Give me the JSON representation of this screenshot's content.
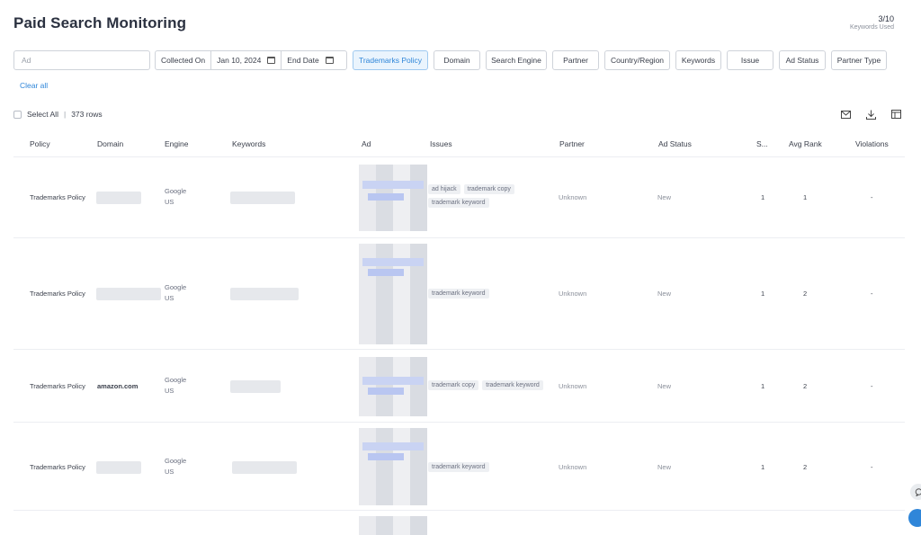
{
  "header": {
    "title": "Paid Search Monitoring",
    "usage_count": "3/10",
    "usage_label": "Keywords Used"
  },
  "filters": {
    "ad_placeholder": "Ad",
    "collected_on_label": "Collected On",
    "start_date": "Jan 10, 2024",
    "end_date_placeholder": "End Date",
    "buttons": [
      "Trademarks Policy",
      "Domain",
      "Search Engine",
      "Partner",
      "Country/Region",
      "Keywords",
      "Issue",
      "Ad Status",
      "Partner Type"
    ],
    "active_filter": "Trademarks Policy",
    "clear_all": "Clear all"
  },
  "selection": {
    "select_all": "Select All",
    "separator": "|",
    "row_count": "373 rows"
  },
  "toolbar_icons": [
    "email-icon",
    "download-icon",
    "columns-icon"
  ],
  "table": {
    "columns": [
      "Policy",
      "Domain",
      "Engine",
      "Keywords",
      "Ad",
      "Issues",
      "Partner",
      "Ad Status",
      "S...",
      "Avg Rank",
      "Violations"
    ],
    "rows": [
      {
        "policy": "Trademarks Policy",
        "domain": "",
        "engine": "Google",
        "region": "US",
        "issues": [
          "ad hijack",
          "trademark copy",
          "trademark keyword"
        ],
        "partner": "Unknown",
        "status": "New",
        "s": "1",
        "avg_rank": "1",
        "violations": "-"
      },
      {
        "policy": "Trademarks Policy",
        "domain": "",
        "engine": "Google",
        "region": "US",
        "issues": [
          "trademark keyword"
        ],
        "partner": "Unknown",
        "status": "New",
        "s": "1",
        "avg_rank": "2",
        "violations": "-"
      },
      {
        "policy": "Trademarks Policy",
        "domain": "amazon.com",
        "engine": "Google",
        "region": "US",
        "issues": [
          "trademark copy",
          "trademark keyword"
        ],
        "partner": "Unknown",
        "status": "New",
        "s": "1",
        "avg_rank": "2",
        "violations": "-"
      },
      {
        "policy": "Trademarks Policy",
        "domain": "",
        "engine": "Google",
        "region": "US",
        "issues": [
          "trademark keyword"
        ],
        "partner": "Unknown",
        "status": "New",
        "s": "1",
        "avg_rank": "2",
        "violations": "-"
      }
    ]
  },
  "colors": {
    "accent": "#2f86d9",
    "active_bg": "#eaf4fd",
    "title": "#2b3140"
  }
}
